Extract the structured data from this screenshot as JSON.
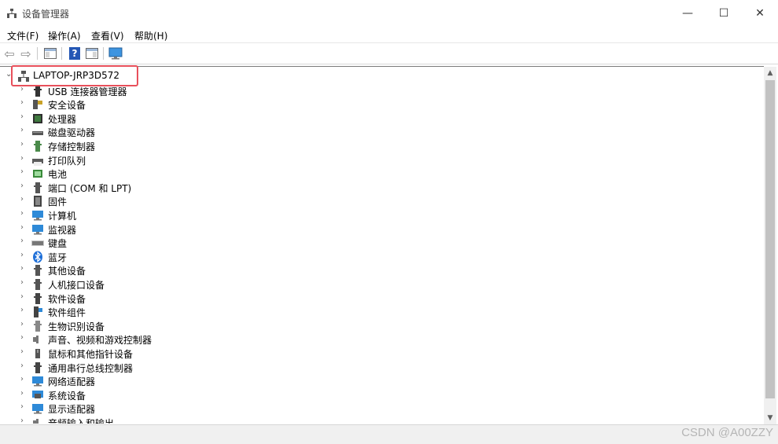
{
  "window": {
    "title": "设备管理器",
    "min_glyph": "—",
    "max_glyph": "☐",
    "close_glyph": "✕"
  },
  "menu": [
    {
      "label": "文件(F)"
    },
    {
      "label": "操作(A)"
    },
    {
      "label": "查看(V)"
    },
    {
      "label": "帮助(H)"
    }
  ],
  "toolbar": {
    "back_glyph": "⇦",
    "forward_glyph": "⇨",
    "help_glyph": "?"
  },
  "tree": {
    "root": {
      "label": "LAPTOP-JRP3D572",
      "chevron": "⌄"
    },
    "chevron": "›",
    "items": [
      {
        "label": "USB 连接器管理器",
        "icon": "usb-connector-icon",
        "color": "#333333"
      },
      {
        "label": "安全设备",
        "icon": "security-device-icon",
        "color": "#c9a227"
      },
      {
        "label": "处理器",
        "icon": "processor-icon",
        "color": "#3f7a3f"
      },
      {
        "label": "磁盘驱动器",
        "icon": "disk-drive-icon",
        "color": "#555555"
      },
      {
        "label": "存储控制器",
        "icon": "storage-controller-icon",
        "color": "#4a8a4a"
      },
      {
        "label": "打印队列",
        "icon": "printer-icon",
        "color": "#5a5a5a"
      },
      {
        "label": "电池",
        "icon": "battery-icon",
        "color": "#3a8a3a"
      },
      {
        "label": "端口 (COM 和 LPT)",
        "icon": "port-icon",
        "color": "#555555"
      },
      {
        "label": "固件",
        "icon": "firmware-icon",
        "color": "#444444"
      },
      {
        "label": "计算机",
        "icon": "computer-icon",
        "color": "#2e8ad8"
      },
      {
        "label": "监视器",
        "icon": "monitor-icon",
        "color": "#2e8ad8"
      },
      {
        "label": "键盘",
        "icon": "keyboard-icon",
        "color": "#777777"
      },
      {
        "label": "蓝牙",
        "icon": "bluetooth-icon",
        "color": "#1e6fd9"
      },
      {
        "label": "其他设备",
        "icon": "other-device-icon",
        "color": "#555555"
      },
      {
        "label": "人机接口设备",
        "icon": "hid-icon",
        "color": "#555555"
      },
      {
        "label": "软件设备",
        "icon": "software-device-icon",
        "color": "#444444"
      },
      {
        "label": "软件组件",
        "icon": "software-component-icon",
        "color": "#2e8ad8"
      },
      {
        "label": "生物识别设备",
        "icon": "biometric-icon",
        "color": "#888888"
      },
      {
        "label": "声音、视频和游戏控制器",
        "icon": "sound-icon",
        "color": "#777777"
      },
      {
        "label": "鼠标和其他指针设备",
        "icon": "mouse-icon",
        "color": "#555555"
      },
      {
        "label": "通用串行总线控制器",
        "icon": "usb-controller-icon",
        "color": "#444444"
      },
      {
        "label": "网络适配器",
        "icon": "network-adapter-icon",
        "color": "#2e8ad8"
      },
      {
        "label": "系统设备",
        "icon": "system-device-icon",
        "color": "#2e8ad8"
      },
      {
        "label": "显示适配器",
        "icon": "display-adapter-icon",
        "color": "#2e8ad8"
      },
      {
        "label": "音频输入和输出",
        "icon": "audio-io-icon",
        "color": "#777777"
      }
    ]
  },
  "scrollbar": {
    "up_glyph": "▲",
    "down_glyph": "▼"
  },
  "watermark": "CSDN @A00ZZY",
  "colors": {
    "highlight": "#e8505b",
    "accent": "#2e8ad8"
  }
}
